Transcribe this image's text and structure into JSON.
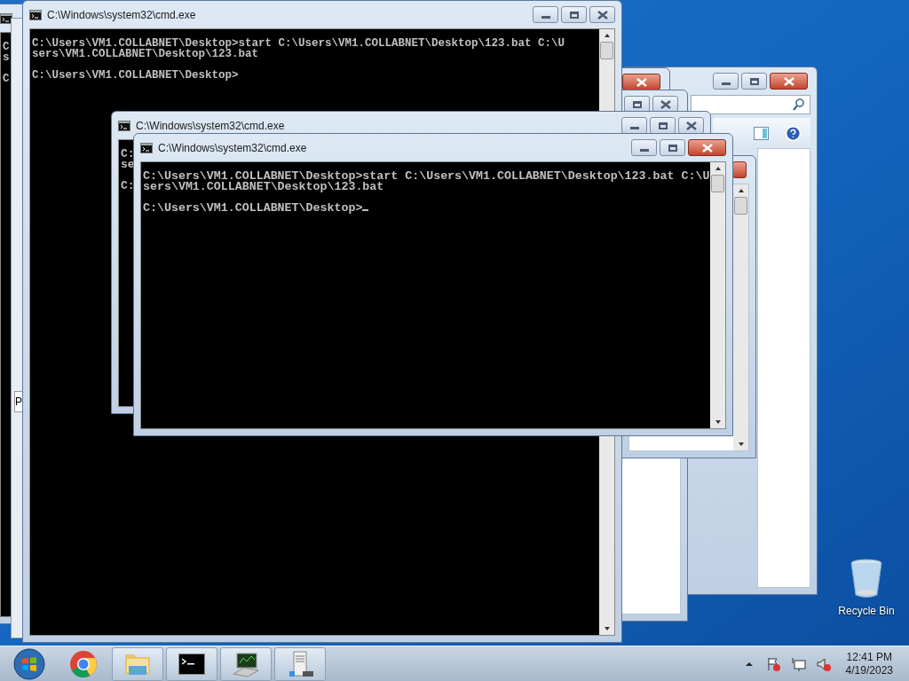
{
  "windows": [
    {
      "kind": "console",
      "blocks": [
        [
          "C",
          "s"
        ],
        [
          "C"
        ]
      ]
    },
    {
      "kind": "panel",
      "label": "P"
    },
    {
      "kind": "explorer",
      "close_hot": true
    },
    {
      "kind": "frame",
      "close_hot": true
    },
    {
      "kind": "frame",
      "close_hot": false
    },
    {
      "kind": "console",
      "title": "C:\\Windows\\system32\\cmd.exe",
      "blocks": [
        [
          "C:\\Users\\VM1.COLLABNET\\Desktop>start C:\\Users\\VM1.COLLABNET\\Desktop\\123.bat C:\\U",
          "sers\\VM1.COLLABNET\\Desktop\\123.bat"
        ],
        [
          "C:\\Users\\VM1.COLLABNET\\Desktop>"
        ]
      ],
      "cursor": false,
      "close_hot": false
    },
    {
      "kind": "frame",
      "close_hot": true
    },
    {
      "kind": "console",
      "title": "C:\\Windows\\system32\\cmd.exe",
      "blocks": [
        [
          "C:",
          "se"
        ],
        [
          "C:"
        ]
      ],
      "cursor": false,
      "close_hot": false
    },
    {
      "kind": "console",
      "title": "C:\\Windows\\system32\\cmd.exe",
      "blocks": [
        [
          "C:\\Users\\VM1.COLLABNET\\Desktop>start C:\\Users\\VM1.COLLABNET\\Desktop\\123.bat C:\\U",
          "sers\\VM1.COLLABNET\\Desktop\\123.bat"
        ],
        [
          "C:\\Users\\VM1.COLLABNET\\Desktop>"
        ]
      ],
      "cursor": true,
      "close_hot": true
    }
  ],
  "desktop_icons": [
    {
      "label": "Recycle Bin"
    }
  ],
  "taskbar": {
    "items": [
      {
        "kind": "start",
        "open": false
      },
      {
        "kind": "chrome",
        "open": false
      },
      {
        "kind": "folder",
        "open": true
      },
      {
        "kind": "console",
        "open": true
      },
      {
        "kind": "monitor",
        "open": true
      },
      {
        "kind": "server",
        "open": true
      }
    ],
    "clock": {
      "time": "12:41 PM",
      "date": "4/19/2023"
    }
  }
}
